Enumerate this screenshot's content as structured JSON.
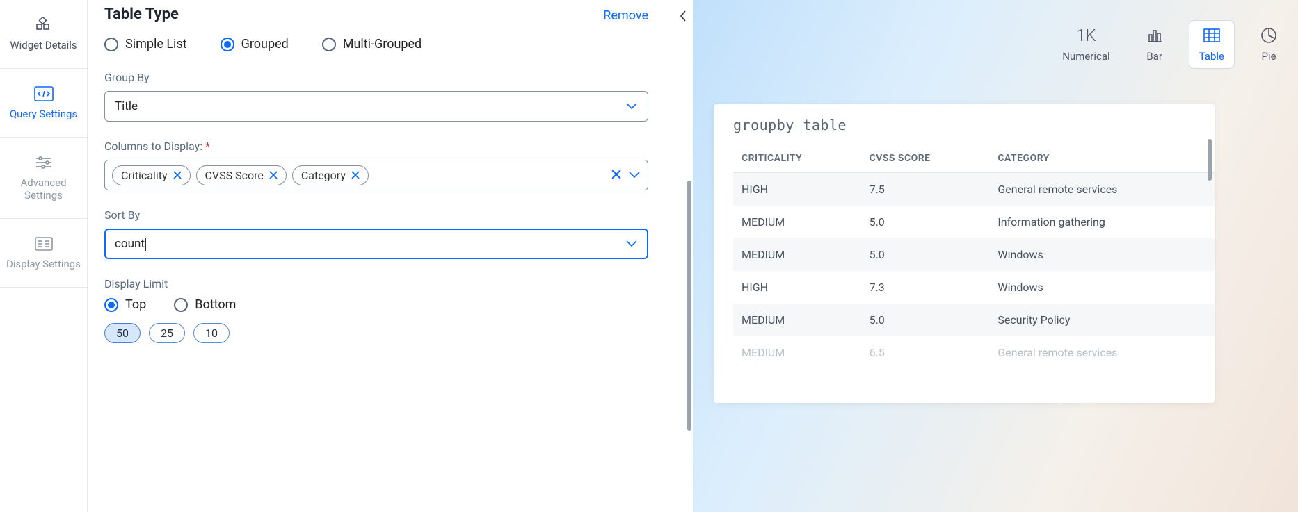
{
  "sidebar": {
    "items": [
      {
        "key": "widget-details",
        "label": "Widget Details",
        "icon": "dashboard"
      },
      {
        "key": "query-settings",
        "label": "Query Settings",
        "icon": "code",
        "active": true
      },
      {
        "key": "advanced-settings",
        "label": "Advanced Settings",
        "icon": "sliders"
      },
      {
        "key": "display-settings",
        "label": "Display Settings",
        "icon": "list"
      }
    ]
  },
  "form": {
    "remove_label": "Remove",
    "table_type": {
      "title": "Table Type",
      "options": {
        "simple": "Simple List",
        "grouped": "Grouped",
        "multi": "Multi-Grouped"
      },
      "selected": "grouped"
    },
    "group_by": {
      "label": "Group By",
      "value": "Title"
    },
    "columns": {
      "label": "Columns to Display:",
      "required": true,
      "chips": [
        "Criticality",
        "CVSS Score",
        "Category"
      ]
    },
    "sort_by": {
      "label": "Sort By",
      "value": "count"
    },
    "display_limit": {
      "label": "Display Limit",
      "direction": {
        "top": "Top",
        "bottom": "Bottom",
        "selected": "top"
      },
      "options": [
        "50",
        "25",
        "10"
      ],
      "selected": "50"
    }
  },
  "preview": {
    "toggles": {
      "numerical": {
        "label": "Numerical",
        "glyph": "1K"
      },
      "bar": {
        "label": "Bar"
      },
      "table": {
        "label": "Table",
        "active": true
      },
      "pie": {
        "label": "Pie"
      }
    },
    "card_title": "groupby_table",
    "columns": [
      "CRITICALITY",
      "CVSS SCORE",
      "CATEGORY"
    ],
    "rows": [
      {
        "c1": "HIGH",
        "c2": "7.5",
        "c3": "General remote services"
      },
      {
        "c1": "MEDIUM",
        "c2": "5.0",
        "c3": "Information gathering"
      },
      {
        "c1": "MEDIUM",
        "c2": "5.0",
        "c3": "Windows"
      },
      {
        "c1": "HIGH",
        "c2": "7.3",
        "c3": "Windows"
      },
      {
        "c1": "MEDIUM",
        "c2": "5.0",
        "c3": "Security Policy"
      },
      {
        "c1": "MEDIUM",
        "c2": "6.5",
        "c3": "General remote services"
      }
    ]
  }
}
